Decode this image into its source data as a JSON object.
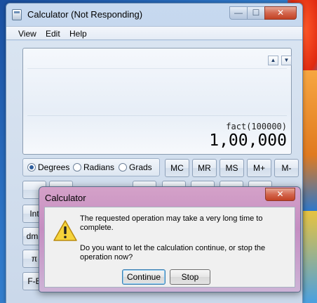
{
  "window": {
    "title": "Calculator (Not Responding)",
    "controls": {
      "minimize": "—",
      "maximize": "☐",
      "close": "✕"
    }
  },
  "menu": [
    "View",
    "Edit",
    "Help"
  ],
  "display": {
    "history_up": "▲",
    "history_down": "▼",
    "expression": "fact(100000)",
    "result": "1,00,000"
  },
  "angle_units": {
    "options": [
      "Degrees",
      "Radians",
      "Grads"
    ],
    "selected": "Degrees"
  },
  "memory_keys": [
    "MC",
    "MR",
    "MS",
    "M+",
    "M-"
  ],
  "left_keys": [
    "Int",
    "dms",
    "π",
    "F-E"
  ],
  "dialog": {
    "title": "Calculator",
    "close": "✕",
    "message1": "The requested operation may take a very long time to complete.",
    "message2": "Do you want to let the calculation continue, or stop the operation now?",
    "continue_label": "Continue",
    "stop_label": "Stop",
    "icon": "warning-icon"
  }
}
